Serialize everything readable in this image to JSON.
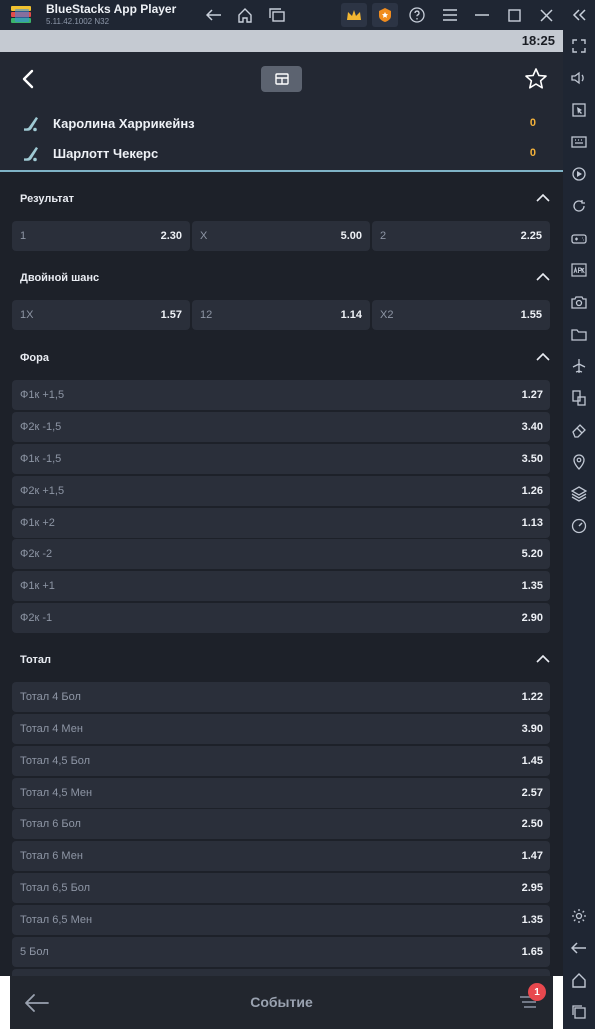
{
  "window": {
    "app_name": "BlueStacks App Player",
    "version": "5.11.42.1002  N32"
  },
  "statusbar": {
    "time": "18:25"
  },
  "match": {
    "teams": [
      {
        "name": "Каролина Харрикейнз",
        "score": "0"
      },
      {
        "name": "Шарлотт Чекерс",
        "score": "0"
      }
    ]
  },
  "sections": {
    "result": {
      "title": "Результат",
      "cells": [
        {
          "label": "1",
          "value": "2.30"
        },
        {
          "label": "X",
          "value": "5.00"
        },
        {
          "label": "2",
          "value": "2.25"
        }
      ]
    },
    "double_chance": {
      "title": "Двойной шанс",
      "cells": [
        {
          "label": "1X",
          "value": "1.57"
        },
        {
          "label": "12",
          "value": "1.14"
        },
        {
          "label": "X2",
          "value": "1.55"
        }
      ]
    },
    "handicap": {
      "title": "Фора",
      "rows": [
        {
          "label": "Ф1к +1,5",
          "value": "1.27"
        },
        {
          "label": "Ф2к -1,5",
          "value": "3.40"
        },
        {
          "label": "Ф1к -1,5",
          "value": "3.50"
        },
        {
          "label": "Ф2к +1,5",
          "value": "1.26"
        },
        {
          "label": "Ф1к +2",
          "value": "1.13"
        },
        {
          "label": "Ф2к -2",
          "value": "5.20"
        },
        {
          "label": "Ф1к +1",
          "value": "1.35"
        },
        {
          "label": "Ф2к -1",
          "value": "2.90"
        }
      ]
    },
    "total": {
      "title": "Тотал",
      "rows": [
        {
          "label": "Тотал 4 Бол",
          "value": "1.22"
        },
        {
          "label": "Тотал 4 Мен",
          "value": "3.90"
        },
        {
          "label": "Тотал 4,5 Бол",
          "value": "1.45"
        },
        {
          "label": "Тотал 4,5 Мен",
          "value": "2.57"
        },
        {
          "label": "Тотал 6 Бол",
          "value": "2.50"
        },
        {
          "label": "Тотал 6 Мен",
          "value": "1.47"
        },
        {
          "label": "Тотал 6,5 Бол",
          "value": "2.95"
        },
        {
          "label": "Тотал 6,5 Мен",
          "value": "1.35"
        },
        {
          "label": "5 Бол",
          "value": "1.65"
        }
      ]
    }
  },
  "bottombar": {
    "title": "Событие",
    "badge": "1"
  },
  "colors": {
    "accent_score": "#f4b23a",
    "badge": "#e8484e",
    "header_line": "#7fb3c6"
  }
}
